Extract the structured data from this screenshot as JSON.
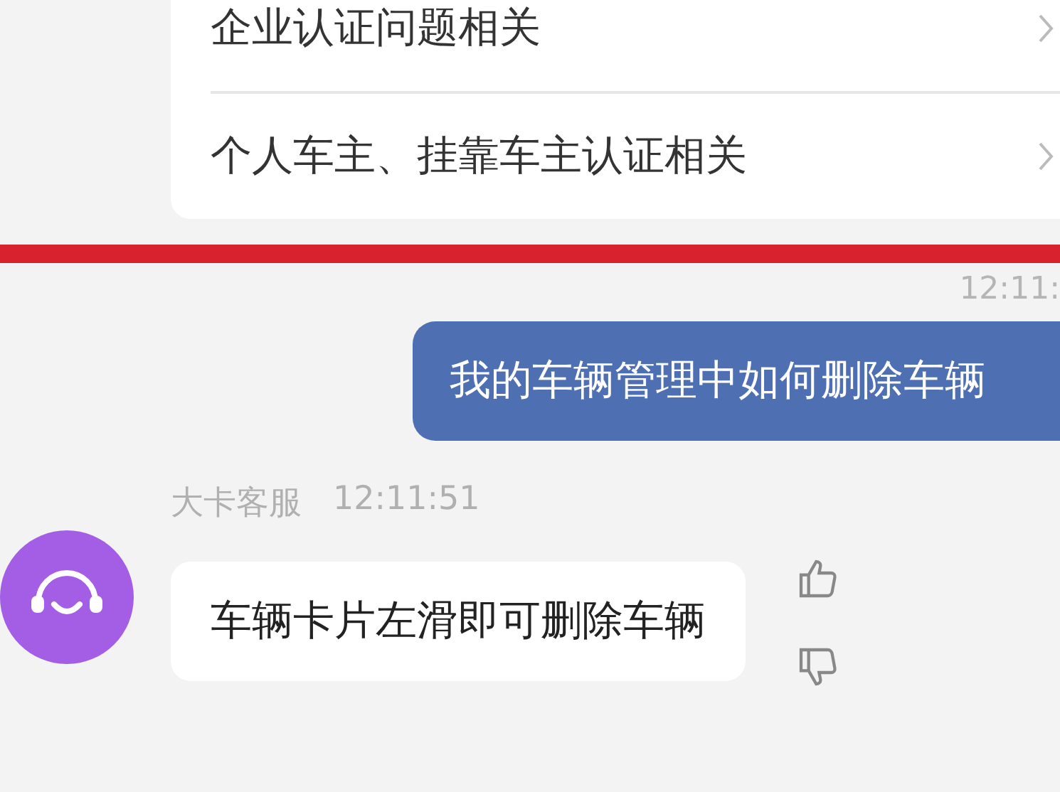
{
  "faq_items": [
    {
      "label": "企业认证问题相关"
    },
    {
      "label": "个人车主、挂靠车主认证相关"
    }
  ],
  "messages": [
    {
      "kind": "user",
      "time": "12:11:",
      "text": "我的车辆管理中如何删除车辆"
    },
    {
      "kind": "bot",
      "sender": "大卡客服",
      "time": "12:11:51",
      "text": "车辆卡片左滑即可删除车辆"
    }
  ]
}
